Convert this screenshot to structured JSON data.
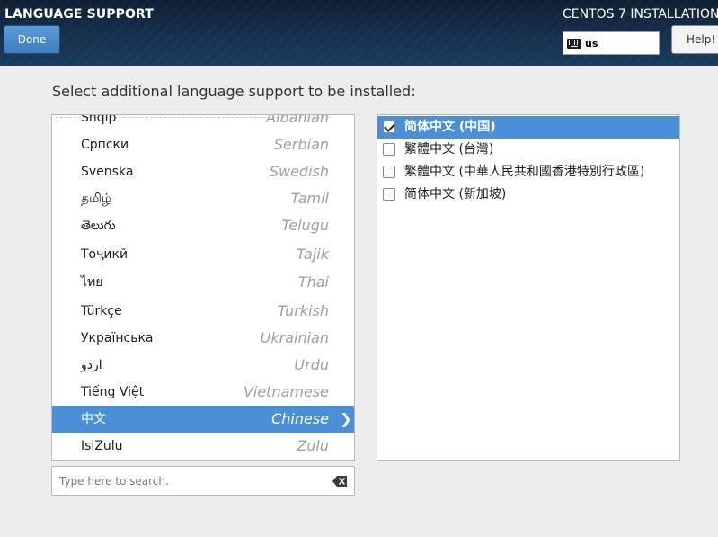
{
  "header": {
    "spoke_title": "LANGUAGE SUPPORT",
    "done_label": "Done",
    "product_title": "CENTOS 7 INSTALLATION",
    "keyboard_layout": "us",
    "help_label": "Help!",
    "help_icon": "keyboard-icon"
  },
  "prompt": "Select additional language support to be installed:",
  "languages": [
    {
      "native": "Shqip",
      "english": "Albanian",
      "selected": false
    },
    {
      "native": "Српски",
      "english": "Serbian",
      "selected": false
    },
    {
      "native": "Svenska",
      "english": "Swedish",
      "selected": false
    },
    {
      "native": "தமிழ்",
      "english": "Tamil",
      "selected": false
    },
    {
      "native": "తెలుగు",
      "english": "Telugu",
      "selected": false
    },
    {
      "native": "Тоҷикӣ",
      "english": "Tajik",
      "selected": false
    },
    {
      "native": "ไทย",
      "english": "Thai",
      "selected": false
    },
    {
      "native": "Türkçe",
      "english": "Turkish",
      "selected": false
    },
    {
      "native": "Українська",
      "english": "Ukrainian",
      "selected": false
    },
    {
      "native": "اردو",
      "english": "Urdu",
      "selected": false
    },
    {
      "native": "Tiếng Việt",
      "english": "Vietnamese",
      "selected": false
    },
    {
      "native": "中文",
      "english": "Chinese",
      "selected": true
    },
    {
      "native": "IsiZulu",
      "english": "Zulu",
      "selected": false
    }
  ],
  "search": {
    "placeholder": "Type here to search.",
    "value": "",
    "clear_icon": "backspace-clear-icon"
  },
  "locales": [
    {
      "label": "简体中文 (中国)",
      "checked": true,
      "selected": true
    },
    {
      "label": "繁體中文 (台灣)",
      "checked": false,
      "selected": false
    },
    {
      "label": "繁體中文 (中華人民共和國香港特別行政區)",
      "checked": false,
      "selected": false
    },
    {
      "label": "简体中文 (新加坡)",
      "checked": false,
      "selected": false
    }
  ],
  "colors": {
    "accent": "#4a90d9",
    "header_dark": "#0f1f33",
    "done_button": "#4a8ccc"
  }
}
